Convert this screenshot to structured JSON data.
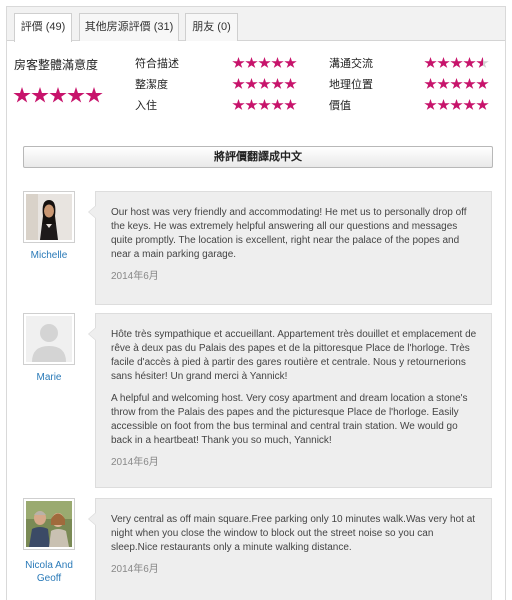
{
  "tabs": [
    {
      "label": "評價 (49)"
    },
    {
      "label": "其他房源評價 (31)"
    },
    {
      "label": "朋友 (0)"
    }
  ],
  "ratings": {
    "overall_label": "房客整體滿意度",
    "overall_stars": 5,
    "categories": [
      {
        "label": "符合描述",
        "stars": 5
      },
      {
        "label": "整潔度",
        "stars": 5
      },
      {
        "label": "入住",
        "stars": 5
      },
      {
        "label": "溝通交流",
        "stars": 4.5
      },
      {
        "label": "地理位置",
        "stars": 5
      },
      {
        "label": "價值",
        "stars": 5
      }
    ],
    "star_color": "#c7136b"
  },
  "translate_button": "將評價翻譯成中文",
  "reviews": [
    {
      "name": "Michelle",
      "paragraphs": [
        "Our host was very friendly and accommodating! He met us to personally drop off the keys. He was extremely helpful answering all our questions and messages quite promptly. The location is excellent, right near the palace of the popes and near a main parking garage."
      ],
      "date": "2014年6月"
    },
    {
      "name": "Marie",
      "paragraphs": [
        "Hôte très sympathique et accueillant. Appartement très douillet et emplacement de rêve à deux pas du Palais des papes et de la pittoresque Place de l'horloge. Très facile d'accès à pied à partir des gares routière et centrale. Nous y retournerions sans hésiter! Un grand merci à Yannick!",
        "A helpful and welcoming host. Very cosy apartment and dream location a stone's throw from the Palais des papes and the picturesque Place de l'horloge. Easily accessible on foot from the bus terminal and central train station. We would go back in a heartbeat! Thank you so much, Yannick!"
      ],
      "date": "2014年6月"
    },
    {
      "name": "Nicola And Geoff",
      "paragraphs": [
        "Very central as off main square.Free parking only 10 minutes walk.Was very hot at night when you close the window to block out the street noise so you can sleep.Nice restaurants only a minute walking distance."
      ],
      "date": "2014年6月"
    }
  ]
}
